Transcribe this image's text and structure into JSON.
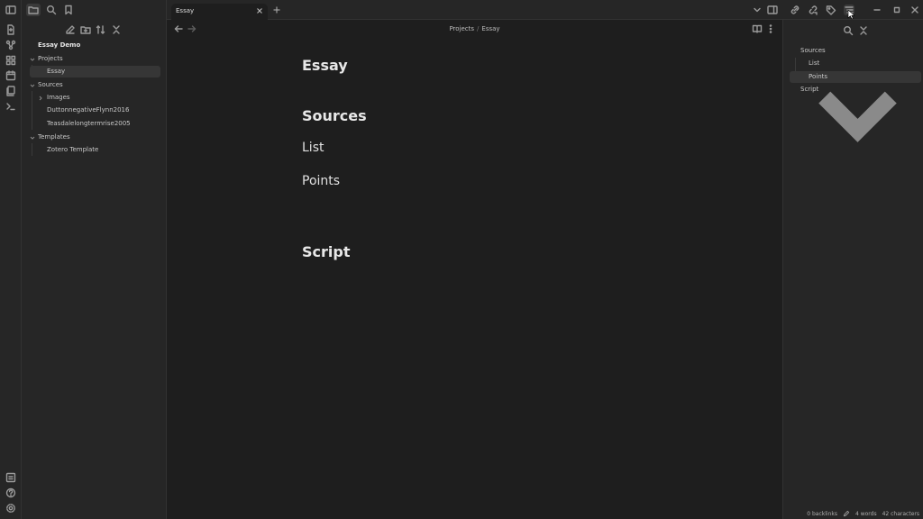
{
  "tab": {
    "title": "Essay"
  },
  "breadcrumb": {
    "folder": "Projects",
    "separator": "/",
    "file": "Essay"
  },
  "file_tree": {
    "vault_name": "Essay Demo",
    "items": [
      {
        "label": "Projects"
      },
      {
        "label": "Essay"
      },
      {
        "label": "Sources"
      },
      {
        "label": "Images"
      },
      {
        "label": "DuttonnegativeFlynn2016"
      },
      {
        "label": "Teasdalelongtermrise2005"
      },
      {
        "label": "Templates"
      },
      {
        "label": "Zotero Template"
      }
    ]
  },
  "document": {
    "title": "Essay",
    "headings": [
      {
        "text": "Sources"
      },
      {
        "text": "List"
      },
      {
        "text": "Points"
      },
      {
        "text": "Script"
      }
    ]
  },
  "outline": {
    "items": [
      {
        "label": "Sources"
      },
      {
        "label": "List"
      },
      {
        "label": "Points"
      },
      {
        "label": "Script"
      }
    ]
  },
  "status_bar": {
    "backlinks": "0 backlinks",
    "words": "4 words",
    "characters": "42 characters"
  },
  "colors": {
    "background": "#1e1e1e",
    "sidebar": "#262626",
    "selected_row": "#363636",
    "text": "#dadada"
  }
}
